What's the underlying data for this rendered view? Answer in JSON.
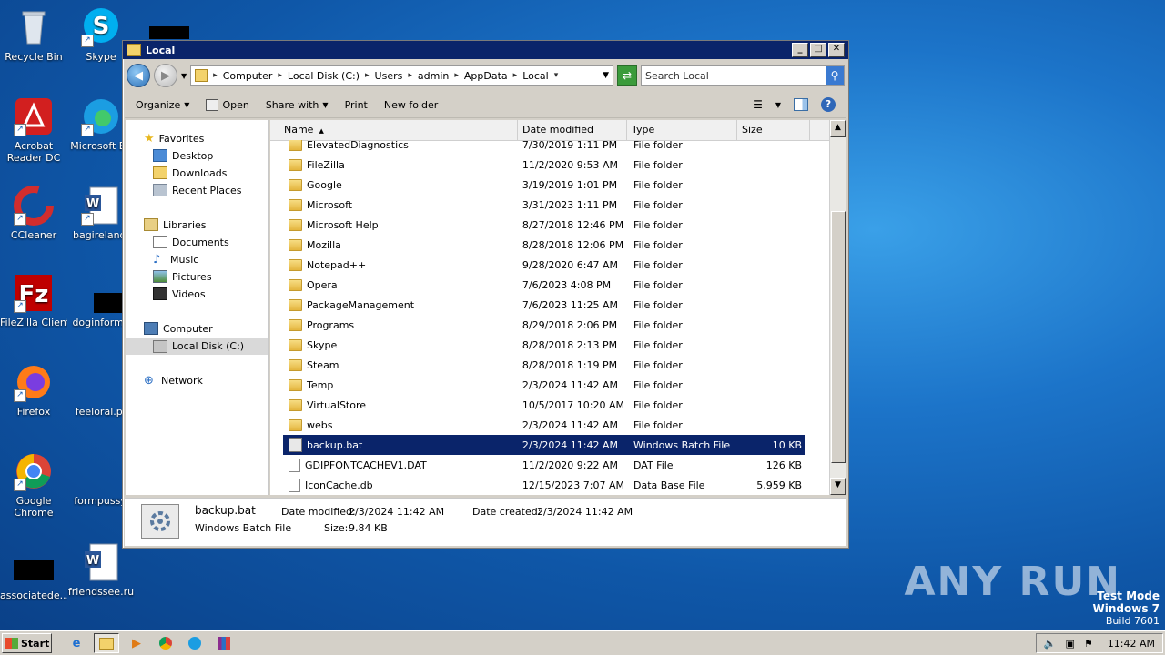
{
  "desktop": {
    "icons": [
      {
        "label": "Recycle Bin"
      },
      {
        "label": "Skype"
      },
      {
        "label": "Acrobat Reader DC"
      },
      {
        "label": "Microsoft Ed"
      },
      {
        "label": "CCleaner"
      },
      {
        "label": "bagireland."
      },
      {
        "label": "FileZilla Client"
      },
      {
        "label": "doginforma"
      },
      {
        "label": "Firefox"
      },
      {
        "label": "feeloral.pr"
      },
      {
        "label": "Google Chrome"
      },
      {
        "label": "formpussy."
      },
      {
        "label": "associatede..."
      },
      {
        "label": "friendssee.ru"
      }
    ]
  },
  "window": {
    "title": "Local",
    "controls": {
      "minimize": "_",
      "maximize": "□",
      "close": "✕"
    },
    "breadcrumb": [
      "Computer",
      "Local Disk (C:)",
      "Users",
      "admin",
      "AppData",
      "Local"
    ],
    "search_placeholder": "Search Local",
    "toolbar": {
      "organize": "Organize",
      "open": "Open",
      "share_with": "Share with",
      "print": "Print",
      "new_folder": "New folder"
    },
    "nav": {
      "favorites": "Favorites",
      "desktop": "Desktop",
      "downloads": "Downloads",
      "recent_places": "Recent Places",
      "libraries": "Libraries",
      "documents": "Documents",
      "music": "Music",
      "pictures": "Pictures",
      "videos": "Videos",
      "computer": "Computer",
      "local_disk": "Local Disk (C:)",
      "network": "Network"
    },
    "columns": {
      "name": "Name",
      "date": "Date modified",
      "type": "Type",
      "size": "Size"
    },
    "files": [
      {
        "name": "ElevatedDiagnostics",
        "date": "7/30/2019 1:11 PM",
        "type": "File folder",
        "size": ""
      },
      {
        "name": "FileZilla",
        "date": "11/2/2020 9:53 AM",
        "type": "File folder",
        "size": ""
      },
      {
        "name": "Google",
        "date": "3/19/2019 1:01 PM",
        "type": "File folder",
        "size": ""
      },
      {
        "name": "Microsoft",
        "date": "3/31/2023 1:11 PM",
        "type": "File folder",
        "size": ""
      },
      {
        "name": "Microsoft Help",
        "date": "8/27/2018 12:46 PM",
        "type": "File folder",
        "size": ""
      },
      {
        "name": "Mozilla",
        "date": "8/28/2018 12:06 PM",
        "type": "File folder",
        "size": ""
      },
      {
        "name": "Notepad++",
        "date": "9/28/2020 6:47 AM",
        "type": "File folder",
        "size": ""
      },
      {
        "name": "Opera",
        "date": "7/6/2023 4:08 PM",
        "type": "File folder",
        "size": ""
      },
      {
        "name": "PackageManagement",
        "date": "7/6/2023 11:25 AM",
        "type": "File folder",
        "size": ""
      },
      {
        "name": "Programs",
        "date": "8/29/2018 2:06 PM",
        "type": "File folder",
        "size": ""
      },
      {
        "name": "Skype",
        "date": "8/28/2018 2:13 PM",
        "type": "File folder",
        "size": ""
      },
      {
        "name": "Steam",
        "date": "8/28/2018 1:19 PM",
        "type": "File folder",
        "size": ""
      },
      {
        "name": "Temp",
        "date": "2/3/2024 11:42 AM",
        "type": "File folder",
        "size": ""
      },
      {
        "name": "VirtualStore",
        "date": "10/5/2017 10:20 AM",
        "type": "File folder",
        "size": ""
      },
      {
        "name": "webs",
        "date": "2/3/2024 11:42 AM",
        "type": "File folder",
        "size": ""
      },
      {
        "name": "backup.bat",
        "date": "2/3/2024 11:42 AM",
        "type": "Windows Batch File",
        "size": "10 KB"
      },
      {
        "name": "GDIPFONTCACHEV1.DAT",
        "date": "11/2/2020 9:22 AM",
        "type": "DAT File",
        "size": "126 KB"
      },
      {
        "name": "IconCache.db",
        "date": "12/15/2023 7:07 AM",
        "type": "Data Base File",
        "size": "5,959 KB"
      }
    ],
    "selected_file": "backup.bat",
    "details": {
      "name": "backup.bat",
      "type": "Windows Batch File",
      "modified_label": "Date modified:",
      "modified": "2/3/2024 11:42 AM",
      "created_label": "Date created:",
      "created": "2/3/2024 11:42 AM",
      "size_label": "Size:",
      "size": "9.84 KB"
    }
  },
  "taskbar": {
    "start": "Start",
    "clock": "11:42 AM"
  },
  "watermark": "ANY RUN",
  "testmode": {
    "line1": "Test Mode",
    "line2": "Windows 7",
    "line3": "Build 7601"
  },
  "colors": {
    "selection": "#0a246a",
    "titlebar": "#0a246a",
    "window_face": "#d4d0c8"
  }
}
